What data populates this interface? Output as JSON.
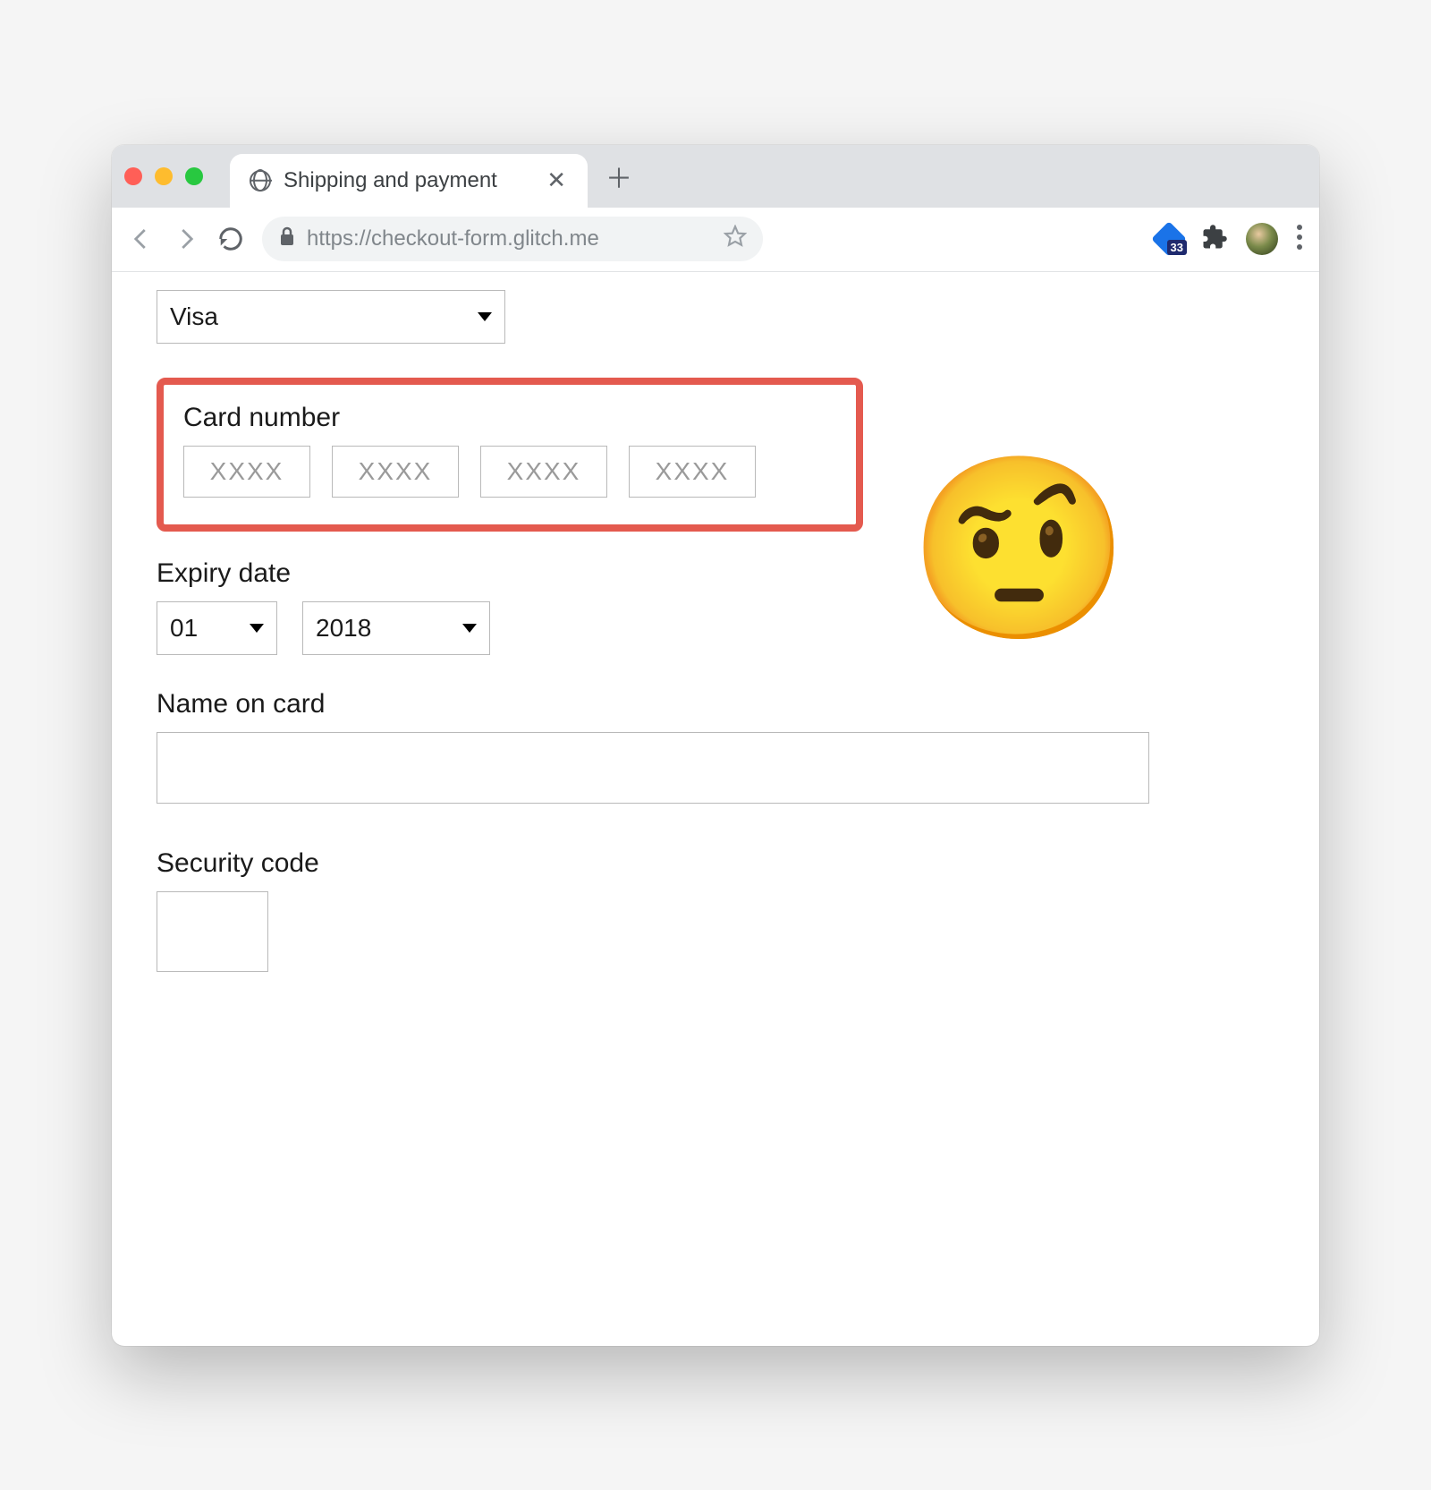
{
  "browser": {
    "tab_title": "Shipping and payment",
    "url": "https://checkout-form.glitch.me",
    "ext_badge_count": "33"
  },
  "form": {
    "card_type": {
      "selected": "Visa"
    },
    "card_number": {
      "label": "Card number",
      "placeholder": "XXXX"
    },
    "expiry": {
      "label": "Expiry date",
      "month": "01",
      "year": "2018"
    },
    "name_on_card": {
      "label": "Name on card"
    },
    "security_code": {
      "label": "Security code"
    }
  },
  "annotation": {
    "emoji": "🤨"
  },
  "colors": {
    "highlight_border": "#e45a4f"
  }
}
